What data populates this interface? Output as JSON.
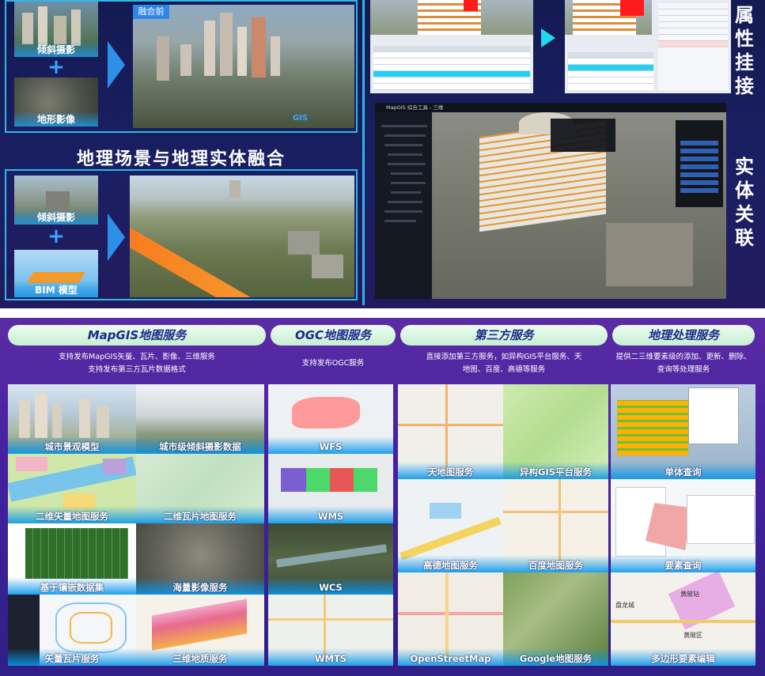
{
  "top": {
    "fusion_before_label": "融合前",
    "left_top": {
      "item1": "倾斜摄影",
      "item2": "地形影像",
      "plus": "+"
    },
    "section_title": "地理场景与地理实体融合",
    "left_bottom": {
      "item1": "倾斜摄影",
      "item2": "BIM 模型",
      "plus": "+"
    },
    "right_titles": {
      "attr": "属性挂接",
      "entity": "实体关联"
    },
    "app_window_title": "MapGIS 综合工具 - 三维",
    "gis_watermark": "GIS"
  },
  "categories": [
    {
      "title": "MapGIS地图服务",
      "desc_lines": [
        "支持发布MapGIS矢量、瓦片、影像、三维服务",
        "支持发布第三方瓦片数据格式"
      ]
    },
    {
      "title": "OGC地图服务",
      "desc_lines": [
        "支持发布OGC服务"
      ]
    },
    {
      "title": "第三方服务",
      "desc_lines": [
        "直接添加第三方服务，如异构GIS平台服务、天",
        "地图、百度、高德等服务"
      ]
    },
    {
      "title": "地理处理服务",
      "desc_lines": [
        "提供二三维要素级的添加、更新、删除、",
        "查询等处理服务"
      ]
    }
  ],
  "tiles": {
    "mapgis": [
      "城市景观模型",
      "城市级倾斜摄影数据",
      "二维矢量地图服务",
      "二维瓦片地图服务",
      "基于镶嵌数据集",
      "海量影像服务",
      "矢量瓦片服务",
      "三维地质服务"
    ],
    "ogc": [
      "WFS",
      "WMS",
      "WCS",
      "WMTS"
    ],
    "third": [
      "天地图服务",
      "异构GIS平台服务",
      "高德地图服务",
      "百度地图服务",
      "OpenStreetMap",
      "Google地图服务"
    ],
    "geoproc": [
      "单体查询",
      "要素查询",
      "多边形要素编辑"
    ]
  },
  "map_small_labels": [
    "黄陂站",
    "盘龙城",
    "黄陂区"
  ],
  "colors": {
    "top_bg": "#161c58",
    "bottom_bg": "#4a23a0",
    "accent_cyan": "#2fb7e6",
    "pill_bg": "#d5f3dd",
    "pill_text": "#1a2a8a"
  }
}
